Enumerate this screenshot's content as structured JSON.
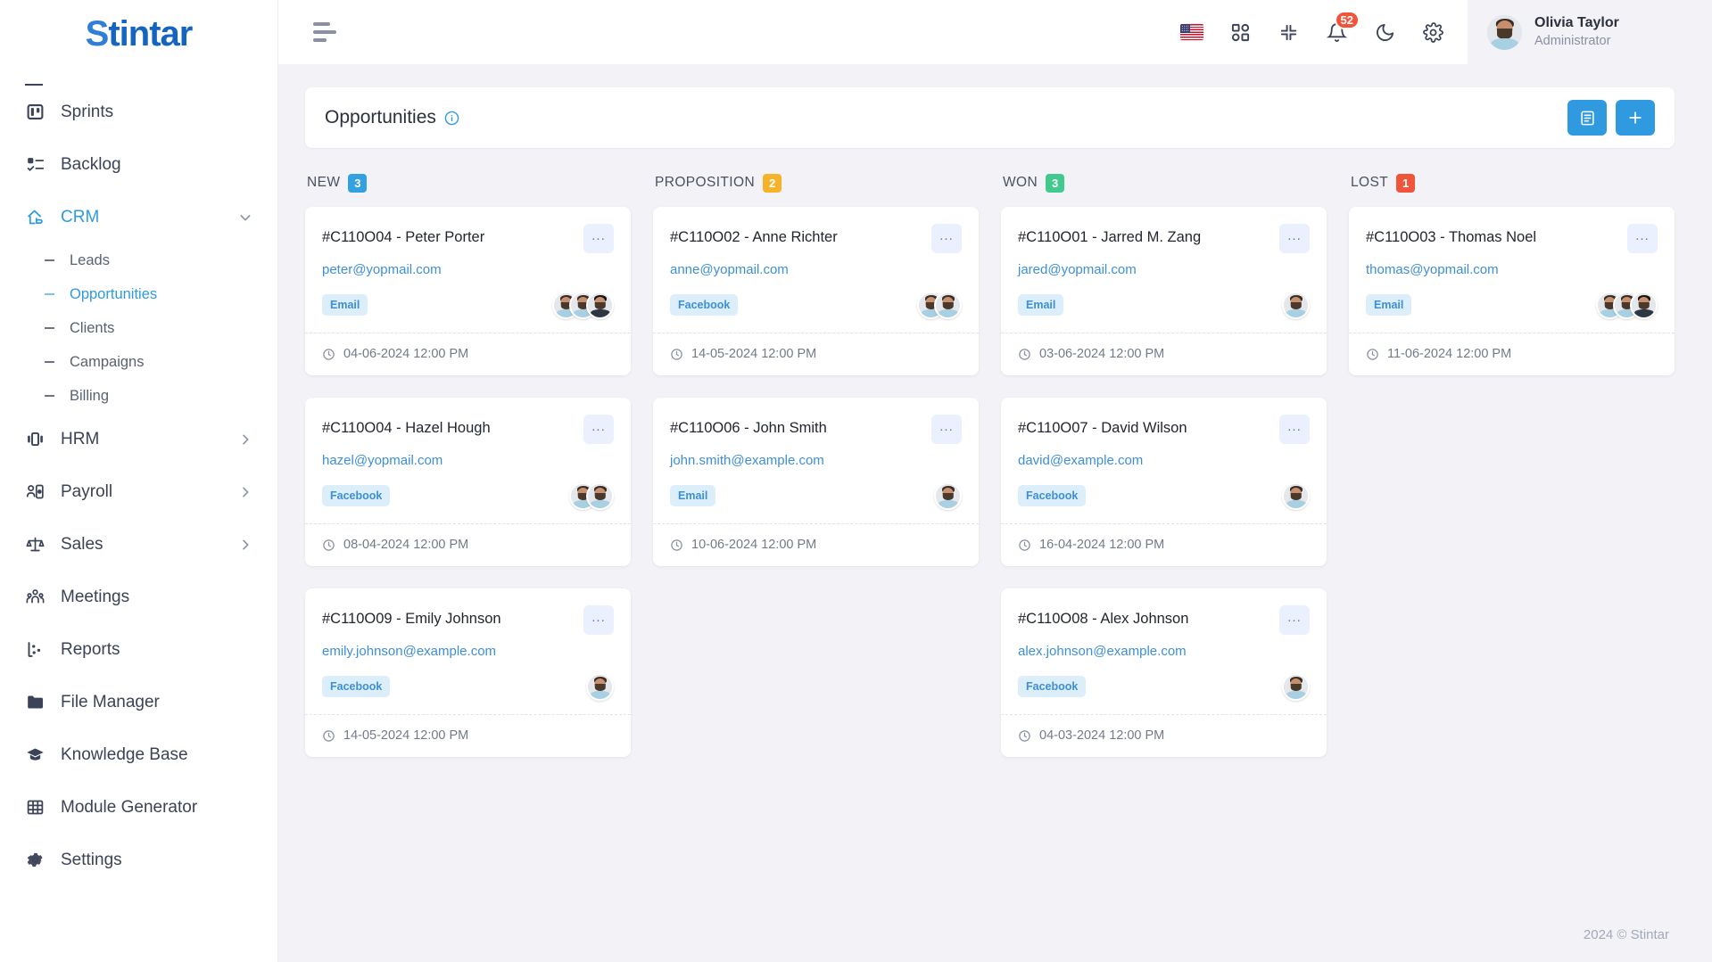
{
  "brand": {
    "name": "Stintar",
    "first_letter": "S",
    "rest": "tintar"
  },
  "sidebar": {
    "items": [
      {
        "label": "Sprints",
        "icon": "board-icon",
        "active": false
      },
      {
        "label": "Backlog",
        "icon": "checklist-icon",
        "active": false
      },
      {
        "label": "CRM",
        "icon": "crm-icon",
        "active": true,
        "expanded": true
      },
      {
        "label": "HRM",
        "icon": "hrm-icon",
        "active": false,
        "chevron": "right"
      },
      {
        "label": "Payroll",
        "icon": "payroll-icon",
        "active": false,
        "chevron": "right"
      },
      {
        "label": "Sales",
        "icon": "scales-icon",
        "active": false,
        "chevron": "right"
      },
      {
        "label": "Meetings",
        "icon": "people-icon",
        "active": false
      },
      {
        "label": "Reports",
        "icon": "scatter-chart-icon",
        "active": false
      },
      {
        "label": "File Manager",
        "icon": "folder-icon",
        "active": false
      },
      {
        "label": "Knowledge Base",
        "icon": "graduation-cap-icon",
        "active": false
      },
      {
        "label": "Module Generator",
        "icon": "grid-table-icon",
        "active": false
      },
      {
        "label": "Settings",
        "icon": "gear-icon",
        "active": false
      }
    ],
    "crm_subitems": [
      {
        "label": "Leads",
        "active": false
      },
      {
        "label": "Opportunities",
        "active": true
      },
      {
        "label": "Clients",
        "active": false
      },
      {
        "label": "Campaigns",
        "active": false
      },
      {
        "label": "Billing",
        "active": false
      }
    ]
  },
  "topbar": {
    "menu_toggle": "hamburger-icon",
    "language_flag": "us-flag-icon",
    "apps_icon": "apps-grid-icon",
    "fullscreen_icon": "compress-icon",
    "notifications_icon": "bell-icon",
    "notifications_count": "52",
    "theme_icon": "moon-icon",
    "settings_icon": "gear-icon",
    "user": {
      "name": "Olivia Taylor",
      "role": "Administrator"
    }
  },
  "page": {
    "title": "Opportunities",
    "info_icon": "info-circle-icon",
    "list_view_button": "list-view-icon",
    "add_button": "plus-icon"
  },
  "colors": {
    "new": "#33a0e0",
    "proposition": "#f5b32b",
    "won": "#41c98e",
    "lost": "#f0543a",
    "accent": "#2f9ae0",
    "link": "#3d8fd6"
  },
  "board": {
    "columns": [
      {
        "name": "NEW",
        "count": "3",
        "color": "#33a0e0",
        "cards": [
          {
            "title": "#C110O04 - Peter Porter",
            "email": "peter@yopmail.com",
            "tag": "Email",
            "date": "04-06-2024 12:00 PM",
            "avatars": 3,
            "menu": "..."
          },
          {
            "title": "#C110O04 - Hazel Hough",
            "email": "hazel@yopmail.com",
            "tag": "Facebook",
            "date": "08-04-2024 12:00 PM",
            "avatars": 2,
            "menu": "..."
          },
          {
            "title": "#C110O09 - Emily Johnson",
            "email": "emily.johnson@example.com",
            "tag": "Facebook",
            "date": "14-05-2024 12:00 PM",
            "avatars": 1,
            "menu": "..."
          }
        ]
      },
      {
        "name": "PROPOSITION",
        "count": "2",
        "color": "#f5b32b",
        "cards": [
          {
            "title": "#C110O02 - Anne Richter",
            "email": "anne@yopmail.com",
            "tag": "Facebook",
            "date": "14-05-2024 12:00 PM",
            "avatars": 2,
            "menu": "..."
          },
          {
            "title": "#C110O06 - John Smith",
            "email": "john.smith@example.com",
            "tag": "Email",
            "date": "10-06-2024 12:00 PM",
            "avatars": 1,
            "menu": "..."
          }
        ]
      },
      {
        "name": "WON",
        "count": "3",
        "color": "#41c98e",
        "cards": [
          {
            "title": "#C110O01 - Jarred M. Zang",
            "email": "jared@yopmail.com",
            "tag": "Email",
            "date": "03-06-2024 12:00 PM",
            "avatars": 1,
            "menu": "..."
          },
          {
            "title": "#C110O07 - David Wilson",
            "email": "david@example.com",
            "tag": "Facebook",
            "date": "16-04-2024 12:00 PM",
            "avatars": 1,
            "menu": "..."
          },
          {
            "title": "#C110O08 - Alex Johnson",
            "email": "alex.johnson@example.com",
            "tag": "Facebook",
            "date": "04-03-2024 12:00 PM",
            "avatars": 1,
            "menu": "..."
          }
        ]
      },
      {
        "name": "LOST",
        "count": "1",
        "color": "#f0543a",
        "cards": [
          {
            "title": "#C110O03 - Thomas Noel",
            "email": "thomas@yopmail.com",
            "tag": "Email",
            "date": "11-06-2024 12:00 PM",
            "avatars": 3,
            "menu": "..."
          }
        ]
      }
    ]
  },
  "footer": {
    "copyright": "2024 © Stintar"
  }
}
